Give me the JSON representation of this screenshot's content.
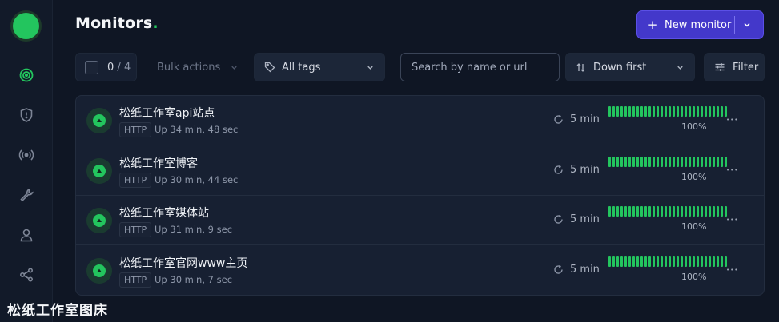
{
  "sidebar": {
    "items": [
      {
        "icon": "monitor-target-icon",
        "active": true
      },
      {
        "icon": "incident-shield-icon",
        "active": false
      },
      {
        "icon": "broadcast-icon",
        "active": false
      },
      {
        "icon": "wrench-icon",
        "active": false
      },
      {
        "icon": "user-icon",
        "active": false
      },
      {
        "icon": "integrations-icon",
        "active": false
      }
    ]
  },
  "header": {
    "title": "Monitors",
    "title_dot": ".",
    "new_monitor_plus": "+",
    "new_monitor_label": "New monitor"
  },
  "toolbar": {
    "selected_count": "0",
    "count_separator": " / ",
    "total_count": "4",
    "bulk_actions_label": "Bulk actions",
    "tags_label": "All tags",
    "search_placeholder": "Search by name or url",
    "sort_label": "Down first",
    "filter_label": "Filter"
  },
  "monitors": [
    {
      "name": "松纸工作室api站点",
      "type": "HTTP",
      "uptime": "Up 34 min, 48 sec",
      "interval": "5 min",
      "uptime_pct": "100%"
    },
    {
      "name": "松纸工作室博客",
      "type": "HTTP",
      "uptime": "Up 30 min, 44 sec",
      "interval": "5 min",
      "uptime_pct": "100%"
    },
    {
      "name": "松纸工作室媒体站",
      "type": "HTTP",
      "uptime": "Up 31 min, 9 sec",
      "interval": "5 min",
      "uptime_pct": "100%"
    },
    {
      "name": "松纸工作室官网www主页",
      "type": "HTTP",
      "uptime": "Up 30 min, 7 sec",
      "interval": "5 min",
      "uptime_pct": "100%"
    }
  ],
  "colors": {
    "accent": "#4338ca",
    "up": "#23c55e",
    "background": "#0f1624",
    "panel": "#172032"
  },
  "watermark": "松纸工作室图床"
}
